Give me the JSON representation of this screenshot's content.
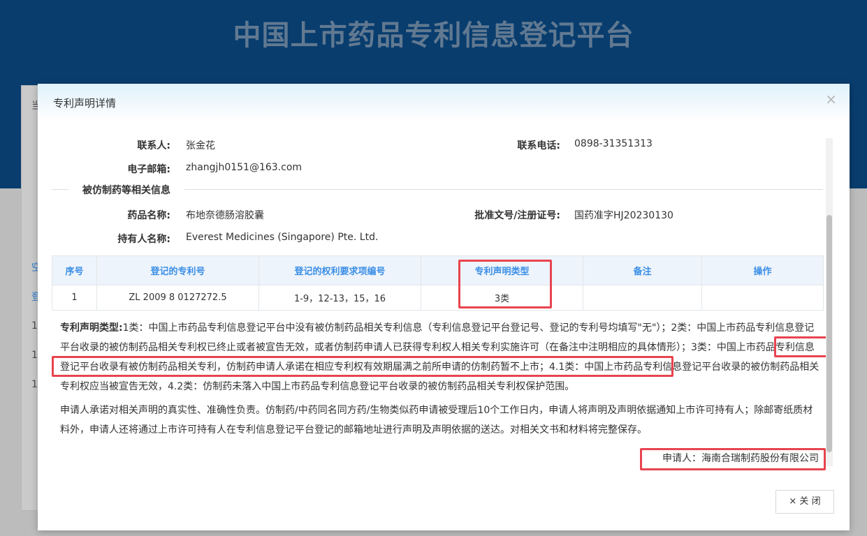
{
  "background": {
    "site_title": "中国上市药品专利信息登记平台",
    "side_glyphs": [
      "当",
      "空",
      "登",
      "1",
      "1",
      "1"
    ]
  },
  "modal": {
    "title": "专利声明详情",
    "close_icon": "close-icon",
    "contact": {
      "contact_label": "联系人:",
      "contact_value": "张金花",
      "phone_label": "联系电话:",
      "phone_value": "0898-31351313",
      "email_label": "电子邮箱:",
      "email_value": "zhangjh0151@163.com"
    },
    "section_title": "被仿制药等相关信息",
    "drug": {
      "name_label": "药品名称:",
      "name_value": "布地奈德肠溶胶囊",
      "approval_label": "批准文号/注册证号:",
      "approval_value": "国药准字HJ20230130",
      "holder_label": "持有人名称:",
      "holder_value": "Everest Medicines (Singapore) Pte. Ltd."
    },
    "table": {
      "headers": [
        "序号",
        "登记的专利号",
        "登记的权利要求项编号",
        "专利声明类型",
        "备注",
        "操作"
      ],
      "rows": [
        [
          "1",
          "ZL 2009 8 0127272.5",
          "1-9，12-13，15，16",
          "3类",
          "",
          ""
        ]
      ]
    },
    "description": {
      "label": "专利声明类型:",
      "part1": "1类：中国上市药品专利信息登记平台中没有被仿制药品相关专利信息（专利信息登记平台登记号、登记的专利号均填写\"无\"）；2类：中国上市药品专利信息登记平台收录的被仿制药品相关专利权已终止或者被宣告无效，或者仿制药申请人已获得专利权人相关专利实施许可（在备注中注明相应的具体情形）；",
      "part2": "3类：中国上市药品专利信息登记平台收录有被仿制药品相关专利，仿制药申请人承诺在相应专利权有效期届满之前所申请的仿制药暂不上市；",
      "part3": "4.1类：中国上市药品专利信息登记平台收录的被仿制药品相关专利权应当被宣告无效，4.2类：仿制药未落入中国上市药品专利信息登记平台收录的被仿制药品相关专利权保护范围。"
    },
    "commitment": "申请人承诺对相关声明的真实性、准确性负责。仿制药/中药同名同方药/生物类似药申请被受理后10个工作日内，申请人将声明及声明依据通知上市许可持有人；除邮寄纸质材料外，申请人还将通过上市许可持有人在专利信息登记平台登记的邮箱地址进行声明及声明依据的送达。对相关文书和材料将完整保存。",
    "applicant": "申请人：海南合瑞制药股份有限公司",
    "close_button": "× 关 闭"
  },
  "colors": {
    "header_bg": "#0a467e",
    "table_header_text": "#3a8ee6",
    "highlight": "#e8444f"
  }
}
